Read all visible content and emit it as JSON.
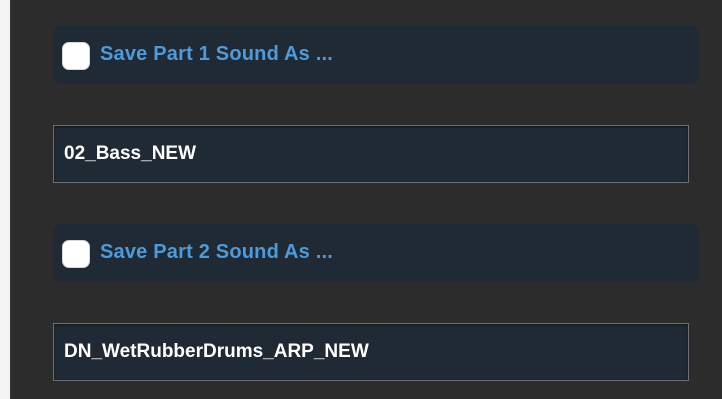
{
  "part1": {
    "save_label": "Save Part 1 Sound As ...",
    "checked": false,
    "name_value": "02_Bass_NEW"
  },
  "part2": {
    "save_label": "Save Part 2 Sound As ...",
    "checked": false,
    "name_value": "DN_WetRubberDrums_ARP_NEW"
  },
  "colors": {
    "background": "#2c2c2c",
    "row_background": "#1f2a35",
    "label_blue": "#4e9bdc",
    "field_text": "#ffffff"
  }
}
